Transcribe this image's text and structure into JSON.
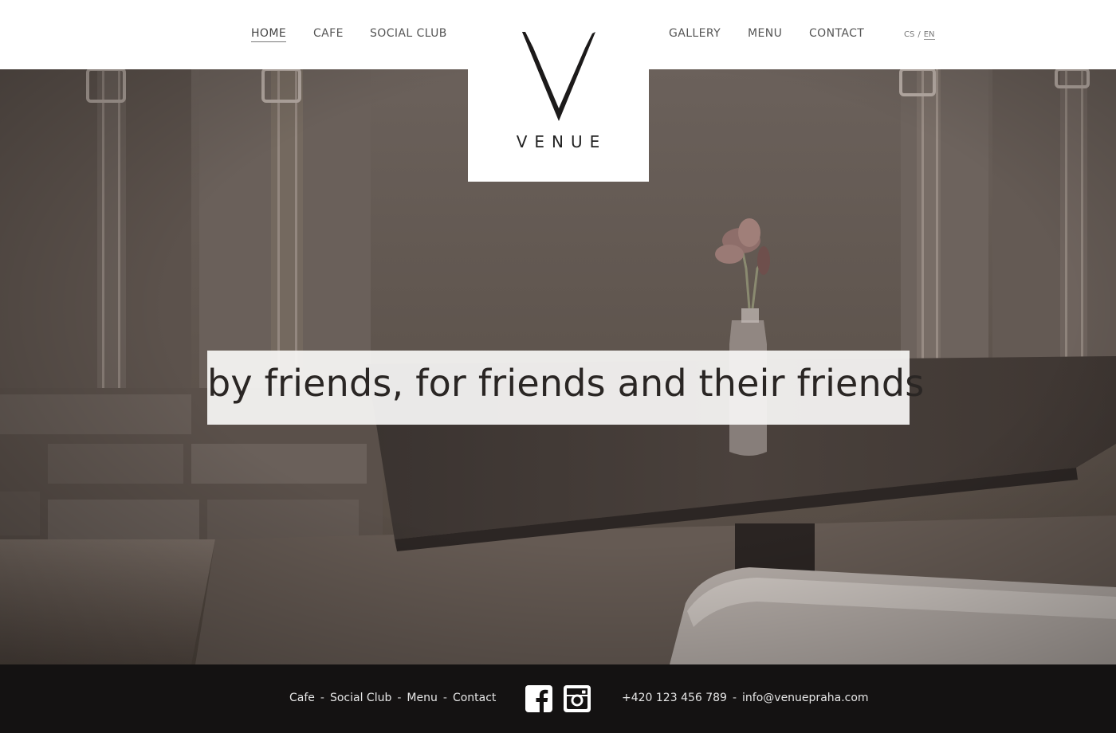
{
  "header": {
    "nav_left": [
      {
        "label": "HOME",
        "active": true
      },
      {
        "label": "CAFE",
        "active": false
      },
      {
        "label": "SOCIAL CLUB",
        "active": false
      }
    ],
    "nav_right": [
      {
        "label": "GALLERY"
      },
      {
        "label": "MENU"
      },
      {
        "label": "CONTACT"
      }
    ],
    "lang": {
      "cs": "CS",
      "separator": "/",
      "en": "EN",
      "current": "EN"
    }
  },
  "logo": {
    "wordmark": "VENUE",
    "icon": "v-logo-mark"
  },
  "hero": {
    "tagline": "by friends, for friends and their friends",
    "image": "cafe-interior-photo"
  },
  "footer": {
    "links": [
      "Cafe",
      "Social Club",
      "Menu",
      "Contact"
    ],
    "link_separator": "-",
    "social": [
      {
        "name": "facebook-icon"
      },
      {
        "name": "instagram-icon"
      }
    ],
    "phone": "+420 123 456 789",
    "email": "info@venuepraha.com",
    "contact_separator": "-"
  },
  "colors": {
    "header_bg": "#ffffff",
    "footer_bg": "#141212",
    "tagline_box": "#f5f4f3",
    "text_dark": "#222222"
  }
}
